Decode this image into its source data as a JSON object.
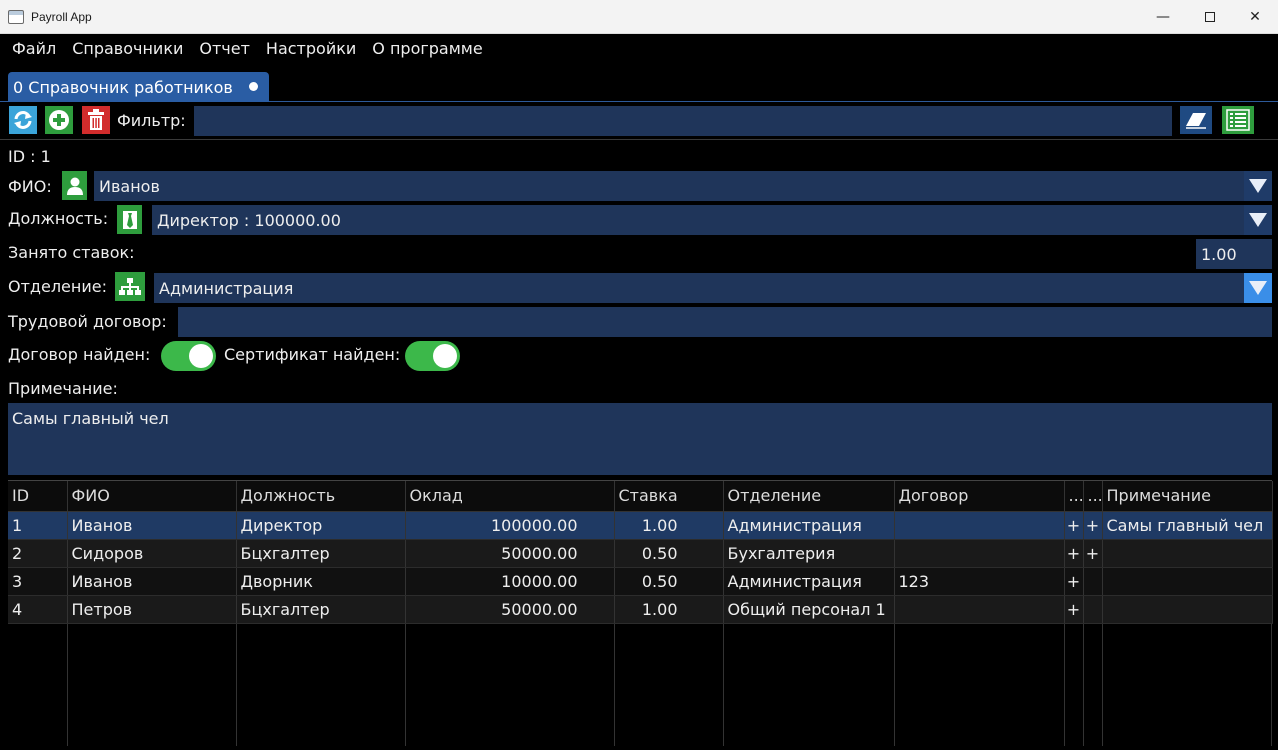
{
  "window": {
    "title": "Payroll App",
    "minimize": "—",
    "close": "✕"
  },
  "menu": [
    "Файл",
    "Справочники",
    "Отчет",
    "Настройки",
    "О программе"
  ],
  "tab": {
    "label": "0 Справочник работников"
  },
  "toolbar": {
    "filter_label": "Фильтр:",
    "filter_value": ""
  },
  "form": {
    "id_text": "ID : 1",
    "fio_label": "ФИО:",
    "fio_value": "Иванов",
    "position_label": "Должность:",
    "position_value": "Директор : 100000.00",
    "rate_label": "Занято ставок:",
    "rate_value": "1.00",
    "department_label": "Отделение:",
    "department_value": "Администрация",
    "contract_label": "Трудовой договор:",
    "contract_value": "",
    "contract_found_label": "Договор найден:",
    "contract_found": true,
    "certificate_found_label": "Сертификат найден:",
    "certificate_found": true,
    "note_label": "Примечание:",
    "note_value": "Самы главный чел"
  },
  "table": {
    "columns": [
      "ID",
      "ФИО",
      "Должность",
      "Оклад",
      "Ставка",
      "Отделение",
      "Договор",
      "...",
      "...",
      "Примечание"
    ],
    "rows": [
      [
        "1",
        "Иванов",
        "Директор",
        "100000.00",
        "1.00",
        "Администрация",
        "",
        "+",
        "+",
        "Самы главный чел"
      ],
      [
        "2",
        "Сидоров",
        "Бцхгалтер",
        "50000.00",
        "0.50",
        "Бухгалтерия",
        "",
        "+",
        "+",
        ""
      ],
      [
        "3",
        "Иванов",
        "Дворник",
        "10000.00",
        "0.50",
        "Администрация",
        "123",
        "+",
        "",
        ""
      ],
      [
        "4",
        "Петров",
        "Бцхгалтер",
        "50000.00",
        "1.00",
        "Общий персонал 1",
        "",
        "+",
        "",
        ""
      ]
    ],
    "selected_row": 0
  },
  "colors": {
    "accent": "#2a5da4",
    "field": "#1f355a",
    "green": "#2e9d3d",
    "toggle": "#3cb84a",
    "danger": "#d22c2c"
  }
}
